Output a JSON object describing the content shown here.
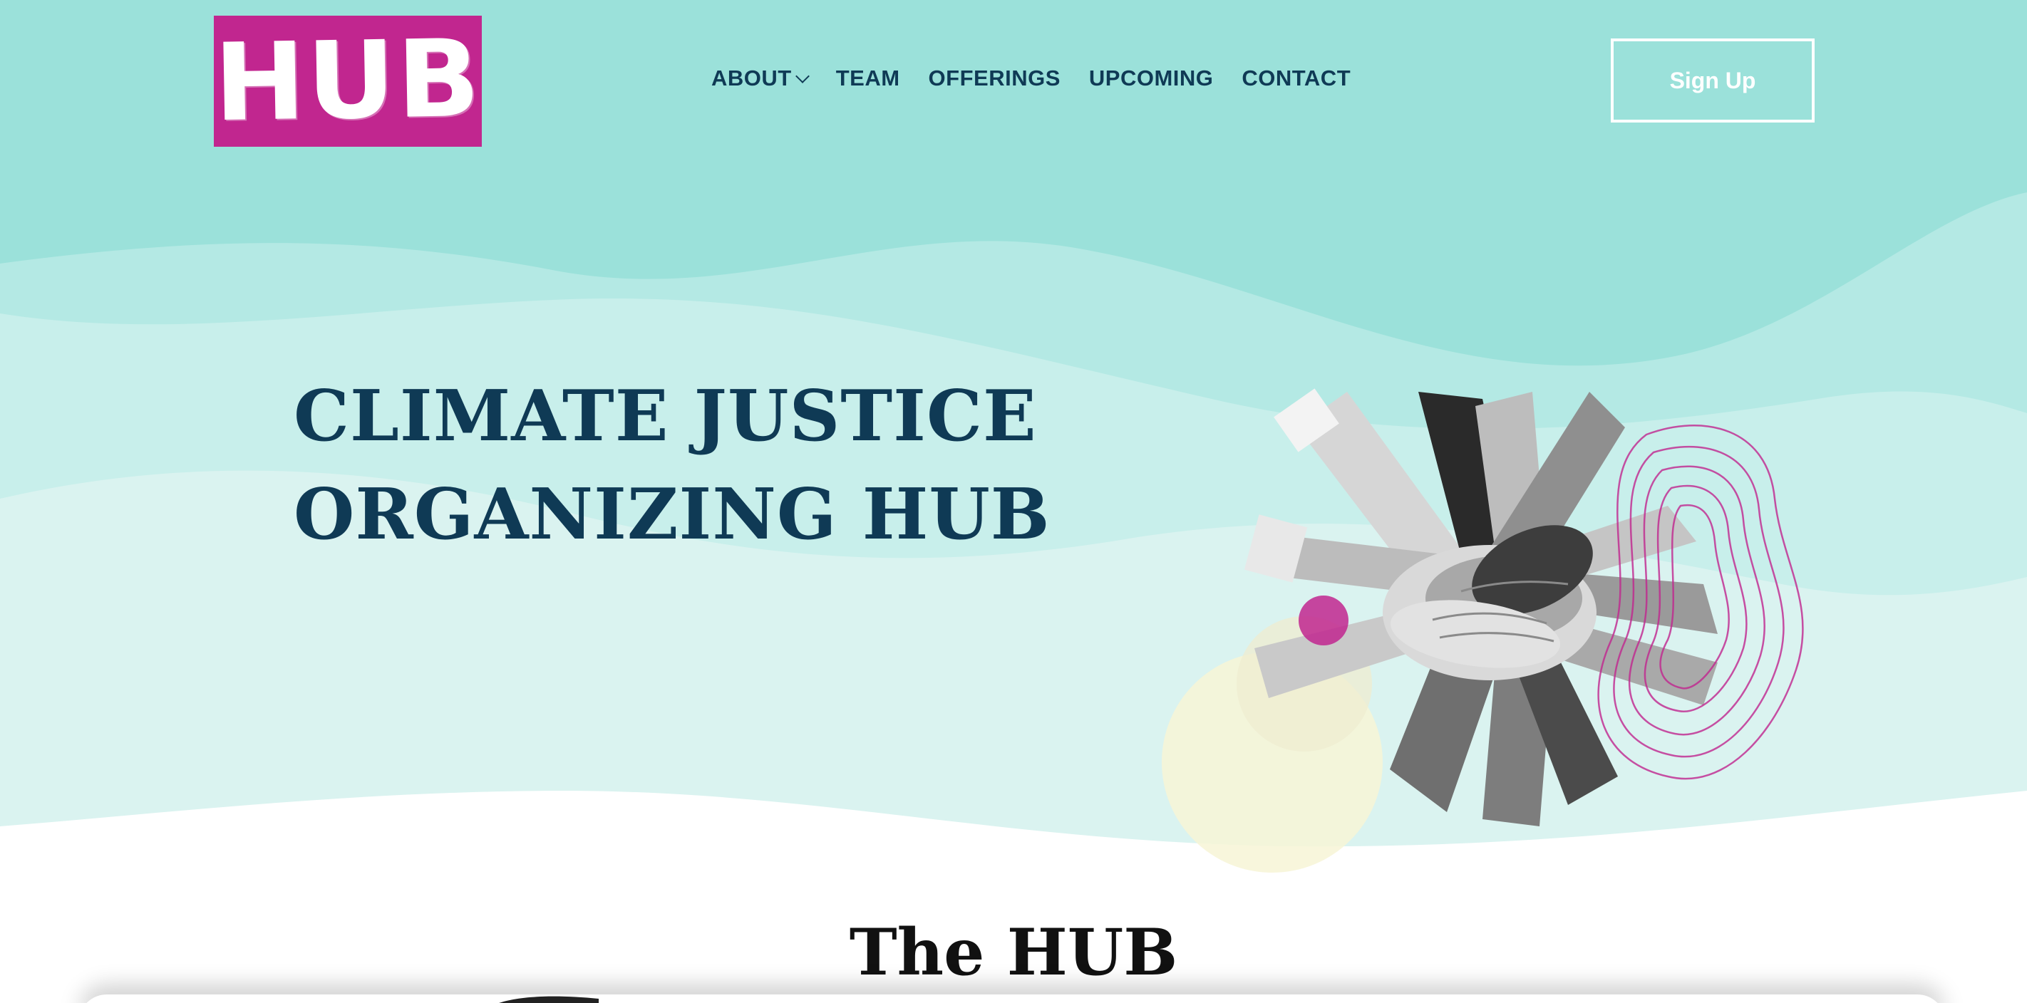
{
  "header": {
    "logo_text": "HUB",
    "nav": [
      {
        "label": "ABOUT",
        "has_dropdown": true
      },
      {
        "label": "TEAM"
      },
      {
        "label": "OFFERINGS"
      },
      {
        "label": "UPCOMING"
      },
      {
        "label": "CONTACT"
      }
    ],
    "signup_label": "Sign Up"
  },
  "hero": {
    "title_line1": "CLIMATE JUSTICE",
    "title_line2": "ORGANIZING HUB"
  },
  "section": {
    "title": "The HUB"
  },
  "colors": {
    "brand_magenta": "#c1268f",
    "hero_teal": "#9be1da",
    "navy_text": "#0f3a55",
    "pale_yellow": "#f6f3d2"
  }
}
